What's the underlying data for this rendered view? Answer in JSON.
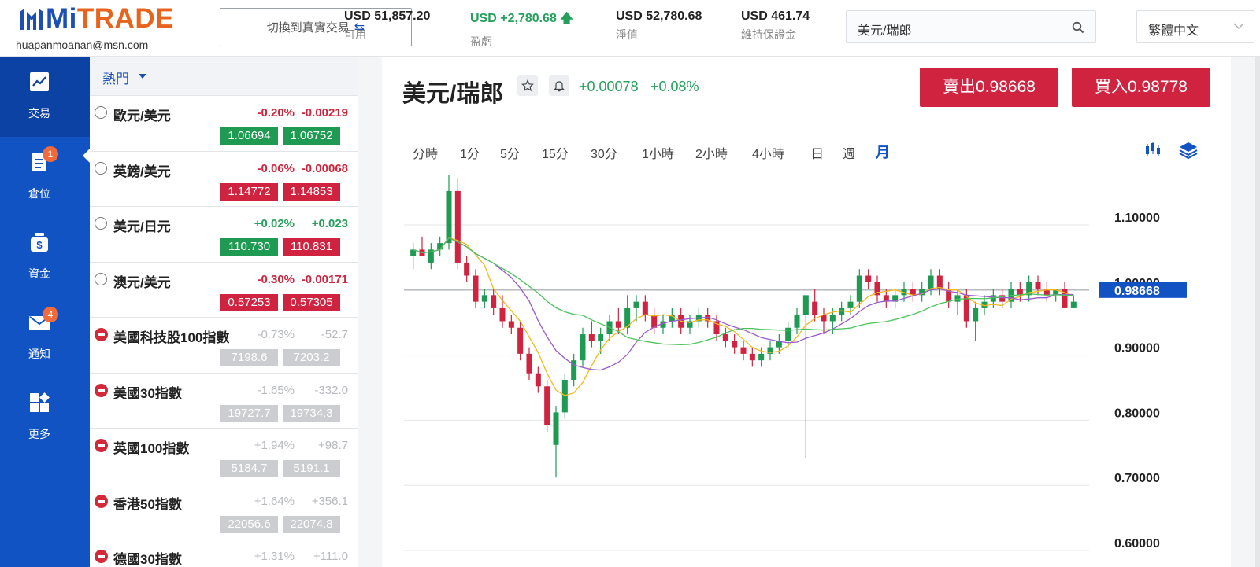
{
  "brand": {
    "logo_part1": "Mi",
    "logo_part2": "TRADE",
    "email": "huapanmoanan@msn.com"
  },
  "header": {
    "switch_label": "切換到真實交易",
    "stats": [
      {
        "value": "USD 51,857.20",
        "label": "可用"
      },
      {
        "value": "USD +2,780.68",
        "label": "盈虧"
      },
      {
        "value": "USD 52,780.68",
        "label": "淨值"
      },
      {
        "value": "USD 461.74",
        "label": "維持保證金"
      }
    ],
    "search_value": "美元/瑞郎",
    "language": "繁體中文"
  },
  "nav": {
    "items": [
      {
        "label": "交易",
        "icon": "chart-line-icon"
      },
      {
        "label": "倉位",
        "icon": "document-list-icon",
        "badge": "1"
      },
      {
        "label": "資金",
        "icon": "money-bag-icon"
      },
      {
        "label": "通知",
        "icon": "envelope-icon",
        "badge": "4"
      },
      {
        "label": "更多",
        "icon": "apps-grid-icon"
      }
    ]
  },
  "market": {
    "tab": "熱門",
    "rows": [
      {
        "name": "歐元/美元",
        "pct": "-0.20%",
        "chg": "-0.00219",
        "bid": "1.06694",
        "ask": "1.06752"
      },
      {
        "name": "英鎊/美元",
        "pct": "-0.06%",
        "chg": "-0.00068",
        "bid": "1.14772",
        "ask": "1.14853"
      },
      {
        "name": "美元/日元",
        "pct": "+0.02%",
        "chg": "+0.023",
        "bid": "110.730",
        "ask": "110.831"
      },
      {
        "name": "澳元/美元",
        "pct": "-0.30%",
        "chg": "-0.00171",
        "bid": "0.57253",
        "ask": "0.57305"
      },
      {
        "name": "美國科技股100指數",
        "pct": "-0.73%",
        "chg": "-52.7",
        "bid": "7198.6",
        "ask": "7203.2"
      },
      {
        "name": "美國30指數",
        "pct": "-1.65%",
        "chg": "-332.0",
        "bid": "19727.7",
        "ask": "19734.3"
      },
      {
        "name": "英國100指數",
        "pct": "+1.94%",
        "chg": "+98.7",
        "bid": "5184.7",
        "ask": "5191.1"
      },
      {
        "name": "香港50指數",
        "pct": "+1.64%",
        "chg": "+356.1",
        "bid": "22056.6",
        "ask": "22074.8"
      },
      {
        "name": "德國30指數",
        "pct": "+1.31%",
        "chg": "+111.0",
        "bid": "",
        "ask": ""
      }
    ]
  },
  "symbol": {
    "title": "美元/瑞郎",
    "change": "+0.00078",
    "change_pct": "+0.08%",
    "sell": "賣出0.98668",
    "buy": "買入0.98778"
  },
  "timeframes": [
    "分時",
    "1分",
    "5分",
    "15分",
    "30分",
    "1小時",
    "2小時",
    "4小時",
    "日",
    "週",
    "月"
  ],
  "chart_data": {
    "type": "candlestick",
    "y_ticks": [
      "1.10000",
      "1.00000",
      "0.90000",
      "0.80000",
      "0.70000",
      "0.60000"
    ],
    "current_price": "0.98668",
    "colors": {
      "up": "#1f9a53",
      "down": "#cf2340",
      "ma_fast": "#f5b81c",
      "ma_mid": "#9b59d0",
      "ma_slow": "#4cc25a"
    },
    "candles": [
      [
        1.04,
        1.06,
        1.02,
        1.05
      ],
      [
        1.05,
        1.07,
        1.04,
        1.04
      ],
      [
        1.03,
        1.06,
        1.02,
        1.05
      ],
      [
        1.05,
        1.07,
        1.04,
        1.06
      ],
      [
        1.06,
        1.17,
        1.05,
        1.14
      ],
      [
        1.14,
        1.16,
        1.02,
        1.03
      ],
      [
        1.03,
        1.04,
        1.0,
        1.01
      ],
      [
        1.01,
        1.02,
        0.96,
        0.97
      ],
      [
        0.97,
        0.99,
        0.96,
        0.98
      ],
      [
        0.98,
        0.99,
        0.95,
        0.96
      ],
      [
        0.96,
        0.98,
        0.93,
        0.94
      ],
      [
        0.94,
        0.95,
        0.92,
        0.93
      ],
      [
        0.93,
        0.94,
        0.88,
        0.89
      ],
      [
        0.89,
        0.9,
        0.85,
        0.86
      ],
      [
        0.86,
        0.87,
        0.83,
        0.84
      ],
      [
        0.84,
        0.85,
        0.77,
        0.78
      ],
      [
        0.75,
        0.81,
        0.7,
        0.8
      ],
      [
        0.8,
        0.86,
        0.79,
        0.85
      ],
      [
        0.85,
        0.89,
        0.84,
        0.88
      ],
      [
        0.88,
        0.93,
        0.87,
        0.92
      ],
      [
        0.92,
        0.94,
        0.9,
        0.91
      ],
      [
        0.91,
        0.93,
        0.89,
        0.92
      ],
      [
        0.92,
        0.95,
        0.91,
        0.94
      ],
      [
        0.94,
        0.96,
        0.92,
        0.93
      ],
      [
        0.93,
        0.98,
        0.92,
        0.96
      ],
      [
        0.96,
        0.98,
        0.94,
        0.97
      ],
      [
        0.97,
        0.98,
        0.94,
        0.95
      ],
      [
        0.95,
        0.96,
        0.92,
        0.93
      ],
      [
        0.93,
        0.95,
        0.92,
        0.94
      ],
      [
        0.94,
        0.96,
        0.93,
        0.95
      ],
      [
        0.95,
        0.96,
        0.92,
        0.93
      ],
      [
        0.93,
        0.95,
        0.92,
        0.94
      ],
      [
        0.94,
        0.96,
        0.93,
        0.95
      ],
      [
        0.95,
        0.96,
        0.93,
        0.94
      ],
      [
        0.94,
        0.95,
        0.91,
        0.92
      ],
      [
        0.92,
        0.93,
        0.9,
        0.91
      ],
      [
        0.91,
        0.92,
        0.89,
        0.9
      ],
      [
        0.9,
        0.91,
        0.88,
        0.89
      ],
      [
        0.89,
        0.9,
        0.87,
        0.88
      ],
      [
        0.88,
        0.9,
        0.87,
        0.89
      ],
      [
        0.89,
        0.91,
        0.88,
        0.9
      ],
      [
        0.9,
        0.92,
        0.89,
        0.91
      ],
      [
        0.91,
        0.94,
        0.9,
        0.93
      ],
      [
        0.93,
        0.96,
        0.92,
        0.95
      ],
      [
        0.95,
        0.98,
        0.73,
        0.98
      ],
      [
        0.97,
        0.99,
        0.94,
        0.95
      ],
      [
        0.95,
        0.96,
        0.92,
        0.94
      ],
      [
        0.94,
        0.96,
        0.92,
        0.95
      ],
      [
        0.95,
        0.97,
        0.94,
        0.96
      ],
      [
        0.96,
        0.98,
        0.95,
        0.97
      ],
      [
        0.97,
        1.02,
        0.96,
        1.01
      ],
      [
        1.01,
        1.02,
        0.99,
        1.0
      ],
      [
        1.0,
        1.01,
        0.97,
        0.98
      ],
      [
        0.98,
        0.99,
        0.96,
        0.97
      ],
      [
        0.97,
        0.99,
        0.96,
        0.98
      ],
      [
        0.98,
        1.0,
        0.97,
        0.99
      ],
      [
        0.99,
        1.0,
        0.97,
        0.98
      ],
      [
        0.98,
        1.0,
        0.97,
        0.99
      ],
      [
        0.99,
        1.02,
        0.98,
        1.01
      ],
      [
        1.01,
        1.02,
        0.98,
        0.99
      ],
      [
        0.99,
        1.0,
        0.96,
        0.97
      ],
      [
        0.97,
        0.99,
        0.95,
        0.98
      ],
      [
        0.98,
        0.99,
        0.93,
        0.94
      ],
      [
        0.94,
        0.97,
        0.91,
        0.96
      ],
      [
        0.96,
        0.98,
        0.95,
        0.97
      ],
      [
        0.97,
        0.99,
        0.96,
        0.98
      ],
      [
        0.98,
        0.99,
        0.96,
        0.97
      ],
      [
        0.97,
        1.0,
        0.96,
        0.99
      ],
      [
        0.99,
        1.0,
        0.97,
        0.98
      ],
      [
        0.98,
        1.01,
        0.97,
        1.0
      ],
      [
        1.0,
        1.01,
        0.98,
        0.99
      ],
      [
        0.99,
        1.0,
        0.97,
        0.98
      ],
      [
        0.98,
        0.99,
        0.97,
        0.99
      ],
      [
        0.99,
        1.0,
        0.96,
        0.96
      ],
      [
        0.96,
        0.98,
        0.96,
        0.97
      ]
    ]
  }
}
